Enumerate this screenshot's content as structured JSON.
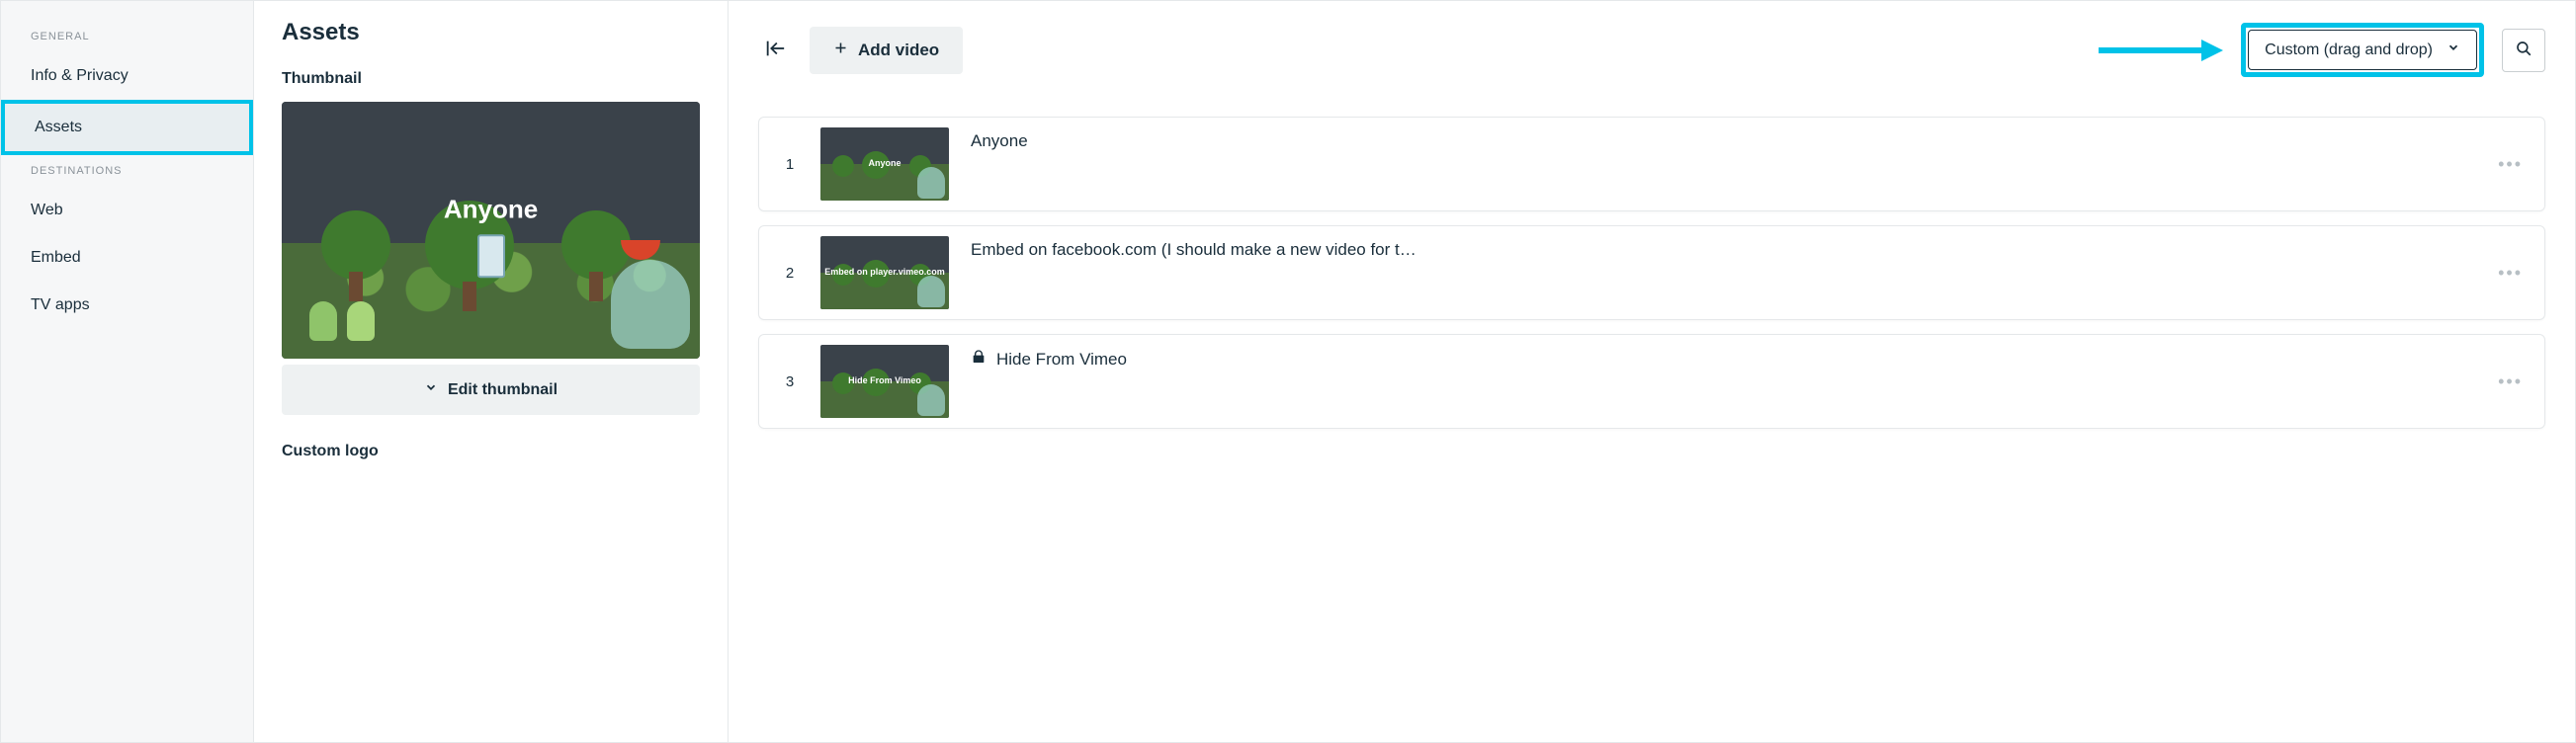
{
  "sidebar": {
    "sections": [
      {
        "label": "GENERAL",
        "items": [
          {
            "label": "Info & Privacy",
            "active": false
          },
          {
            "label": "Assets",
            "active": true
          }
        ]
      },
      {
        "label": "DESTINATIONS",
        "items": [
          {
            "label": "Web",
            "active": false
          },
          {
            "label": "Embed",
            "active": false
          },
          {
            "label": "TV apps",
            "active": false
          }
        ]
      }
    ]
  },
  "middle": {
    "title": "Assets",
    "thumbnail_section": "Thumbnail",
    "thumbnail_overlay_text": "Anyone",
    "edit_thumbnail_label": "Edit thumbnail",
    "custom_logo_section": "Custom logo"
  },
  "right": {
    "add_video_label": "Add video",
    "sort_label": "Custom (drag and drop)",
    "videos": [
      {
        "index": "1",
        "title": "Anyone",
        "thumb_caption": "Anyone",
        "locked": false
      },
      {
        "index": "2",
        "title": "Embed on facebook.com (I should make a new video for t…",
        "thumb_caption": "Embed on player.vimeo.com",
        "locked": false
      },
      {
        "index": "3",
        "title": "Hide From Vimeo",
        "thumb_caption": "Hide From Vimeo",
        "locked": true
      }
    ]
  },
  "colors": {
    "highlight": "#00c2e8"
  }
}
